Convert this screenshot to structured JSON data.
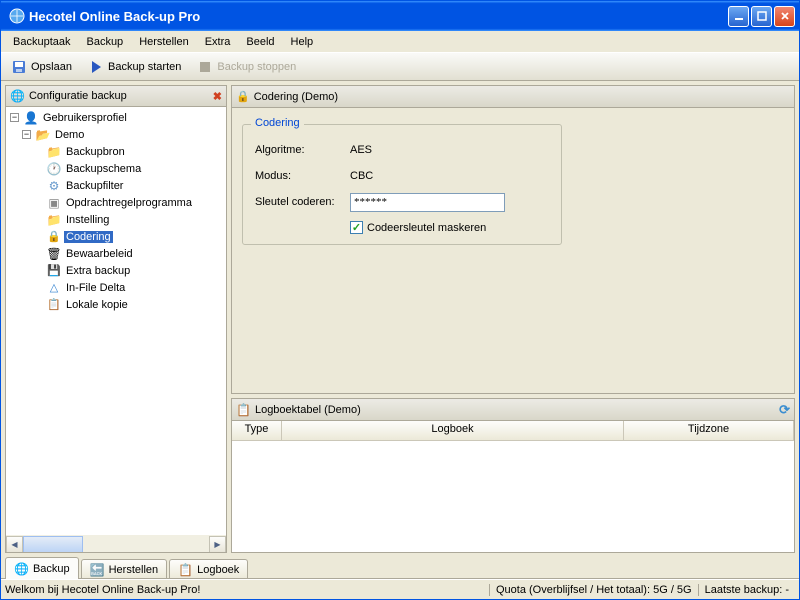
{
  "titlebar": {
    "title": "Hecotel Online Back-up Pro"
  },
  "menubar": [
    "Backuptaak",
    "Backup",
    "Herstellen",
    "Extra",
    "Beeld",
    "Help"
  ],
  "toolbar": {
    "save_label": "Opslaan",
    "start_label": "Backup starten",
    "stop_label": "Backup stoppen"
  },
  "sidebar": {
    "title": "Configuratie backup",
    "items": [
      {
        "label": "Gebruikersprofiel"
      },
      {
        "label": "Demo"
      },
      {
        "label": "Backupbron"
      },
      {
        "label": "Backupschema"
      },
      {
        "label": "Backupfilter"
      },
      {
        "label": "Opdrachtregelprogramma"
      },
      {
        "label": "Instelling"
      },
      {
        "label": "Codering"
      },
      {
        "label": "Bewaarbeleid"
      },
      {
        "label": "Extra backup"
      },
      {
        "label": "In-File Delta"
      },
      {
        "label": "Lokale kopie"
      }
    ]
  },
  "coding_panel": {
    "title": "Codering (Demo)",
    "group_title": "Codering",
    "rows": {
      "algo_label": "Algoritme:",
      "algo_value": "AES",
      "mode_label": "Modus:",
      "mode_value": "CBC",
      "key_label": "Sleutel coderen:",
      "key_value": "******"
    },
    "mask_label": "Codeersleutel maskeren"
  },
  "log_panel": {
    "title": "Logboektabel (Demo)",
    "cols": {
      "type": "Type",
      "log": "Logboek",
      "tz": "Tijdzone"
    }
  },
  "tabs": [
    "Backup",
    "Herstellen",
    "Logboek"
  ],
  "statusbar": {
    "welcome": "Welkom bij Hecotel Online Back-up Pro!",
    "quota": "Quota (Overblijfsel / Het totaal): 5G / 5G",
    "last": "Laatste backup:  -"
  }
}
